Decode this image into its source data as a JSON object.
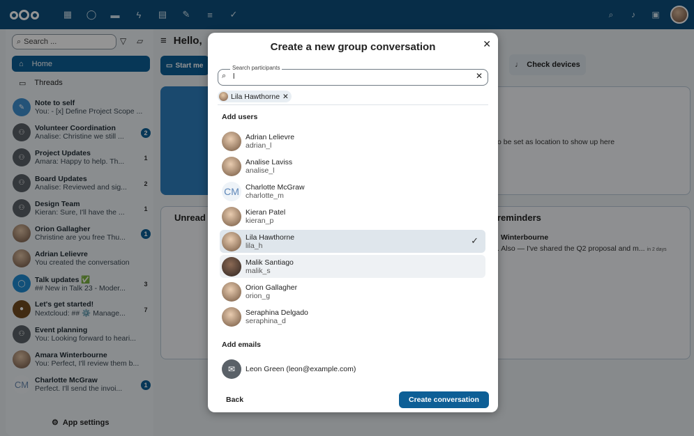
{
  "topbar": {
    "apps": [
      "dashboard-icon",
      "talk-icon",
      "files-icon",
      "activity-icon",
      "calendar-icon",
      "notes-icon",
      "deck-icon",
      "tasks-icon"
    ],
    "right_icons": [
      "search-icon",
      "notifications-icon",
      "contacts-icon"
    ]
  },
  "sidebar": {
    "search_placeholder": "Search ...",
    "home_label": "Home",
    "threads_label": "Threads",
    "app_settings_label": "App settings",
    "conversations": [
      {
        "name": "Note to self",
        "last": "You: - [x] Define Project Scope ...",
        "badge": "",
        "avatar": "note"
      },
      {
        "name": "Volunteer Coordination",
        "last": "Analise: Christine we still ...",
        "badge": "2",
        "avatar": "group"
      },
      {
        "name": "Project Updates",
        "last": "Amara: Happy to help. Th...",
        "badge": "1",
        "avatar": "group"
      },
      {
        "name": "Board Updates",
        "last": "Analise: Reviewed and sig...",
        "badge": "2",
        "avatar": "group"
      },
      {
        "name": "Design Team",
        "last": "Kieran: Sure, I'll have the ...",
        "badge": "1",
        "avatar": "group"
      },
      {
        "name": "Orion Gallagher",
        "last": "Christine are you free Thu...",
        "badge": "1",
        "avatar": "photo"
      },
      {
        "name": "Adrian Lelievre",
        "last": "You created the conversation",
        "badge": "",
        "avatar": "photo"
      },
      {
        "name": "Talk updates ✅",
        "last": "## New in Talk 23 - Moder...",
        "badge": "3",
        "avatar": "blue"
      },
      {
        "name": "Let's get started!",
        "last": "Nextcloud: ## ⚙️ Manage...",
        "badge": "7",
        "avatar": "orange"
      },
      {
        "name": "Event planning",
        "last": "You: Looking forward to heari...",
        "badge": "",
        "avatar": "group"
      },
      {
        "name": "Amara Winterbourne",
        "last": "You: Perfect, I'll review them b...",
        "badge": "",
        "avatar": "photo"
      },
      {
        "name": "Charlotte McGraw",
        "last": "Perfect. I'll send the invoi...",
        "badge": "1",
        "avatar": "cm"
      }
    ]
  },
  "main": {
    "header": "Hello,",
    "start_label": "Start me",
    "check_devices_label": "Check devices",
    "location_text": "o be set as location to show up here",
    "unread_title": "Unread",
    "reminders_title": "reminders",
    "reminder_name": "Winterbourne",
    "reminder_text": ". Also — I've shared the Q2 proposal and m...",
    "reminder_time": "in 2 days"
  },
  "modal": {
    "title": "Create a new group conversation",
    "search_legend": "Search participants",
    "search_value": "l",
    "chip_label": "Lila Hawthorne",
    "add_users_label": "Add users",
    "users": [
      {
        "name": "Adrian Lelievre",
        "id": "adrian_l",
        "avatar": "photo",
        "state": ""
      },
      {
        "name": "Analise Laviss",
        "id": "analise_l",
        "avatar": "photo",
        "state": ""
      },
      {
        "name": "Charlotte McGraw",
        "id": "charlotte_m",
        "avatar": "CM",
        "state": ""
      },
      {
        "name": "Kieran Patel",
        "id": "kieran_p",
        "avatar": "photo",
        "state": ""
      },
      {
        "name": "Lila Hawthorne",
        "id": "lila_h",
        "avatar": "photo",
        "state": "selected"
      },
      {
        "name": "Malik Santiago",
        "id": "malik_s",
        "avatar": "dark",
        "state": "hover"
      },
      {
        "name": "Orion Gallagher",
        "id": "orion_g",
        "avatar": "photo",
        "state": ""
      },
      {
        "name": "Seraphina Delgado",
        "id": "seraphina_d",
        "avatar": "photo",
        "state": ""
      }
    ],
    "add_emails_label": "Add emails",
    "email_entry": "Leon Green (leon@example.com)",
    "back_label": "Back",
    "create_label": "Create conversation"
  }
}
